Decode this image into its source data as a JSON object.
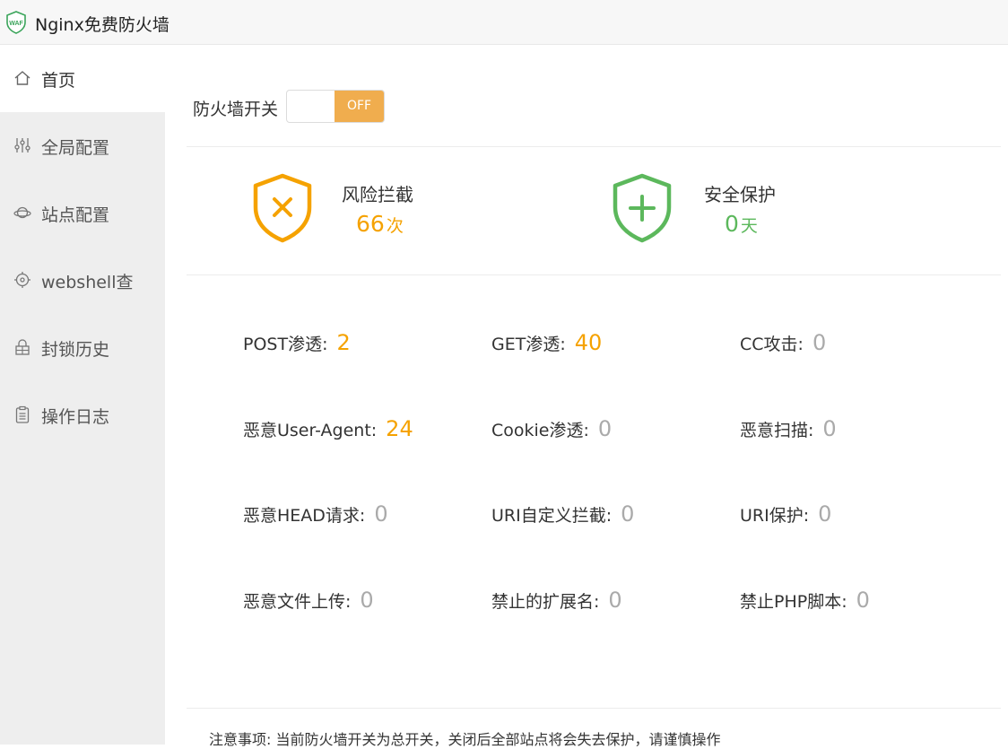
{
  "app": {
    "title": "Nginx免费防火墙",
    "logo_text": "WAF"
  },
  "sidebar": {
    "items": [
      {
        "label": "首页",
        "icon": "home-icon",
        "active": true
      },
      {
        "label": "全局配置",
        "icon": "sliders-icon",
        "active": false
      },
      {
        "label": "站点配置",
        "icon": "planet-icon",
        "active": false
      },
      {
        "label": "webshell查",
        "icon": "target-icon",
        "active": false
      },
      {
        "label": "封锁历史",
        "icon": "lock-icon",
        "active": false
      },
      {
        "label": "操作日志",
        "icon": "clipboard-icon",
        "active": false
      }
    ]
  },
  "firewall_switch": {
    "label": "防火墙开关",
    "state": "OFF"
  },
  "stats": {
    "risk": {
      "title": "风险拦截",
      "value": "66",
      "unit": "次",
      "color": "#f5a200"
    },
    "safe": {
      "title": "安全保护",
      "value": "0",
      "unit": "天",
      "color": "#5cb85c"
    }
  },
  "metrics": [
    {
      "label": "POST渗透:",
      "value": "2",
      "tone": "orange"
    },
    {
      "label": "GET渗透:",
      "value": "40",
      "tone": "orange"
    },
    {
      "label": "CC攻击:",
      "value": "0",
      "tone": "gray"
    },
    {
      "label": "恶意User-Agent:",
      "value": "24",
      "tone": "orange"
    },
    {
      "label": "Cookie渗透:",
      "value": "0",
      "tone": "gray"
    },
    {
      "label": "恶意扫描:",
      "value": "0",
      "tone": "gray"
    },
    {
      "label": "恶意HEAD请求:",
      "value": "0",
      "tone": "gray"
    },
    {
      "label": "URI自定义拦截:",
      "value": "0",
      "tone": "gray"
    },
    {
      "label": "URI保护:",
      "value": "0",
      "tone": "gray"
    },
    {
      "label": "恶意文件上传:",
      "value": "0",
      "tone": "gray"
    },
    {
      "label": "禁止的扩展名:",
      "value": "0",
      "tone": "gray"
    },
    {
      "label": "禁止PHP脚本:",
      "value": "0",
      "tone": "gray"
    }
  ],
  "notice": "注意事项: 当前防火墙开关为总开关，关闭后全部站点将会失去保护，请谨慎操作"
}
